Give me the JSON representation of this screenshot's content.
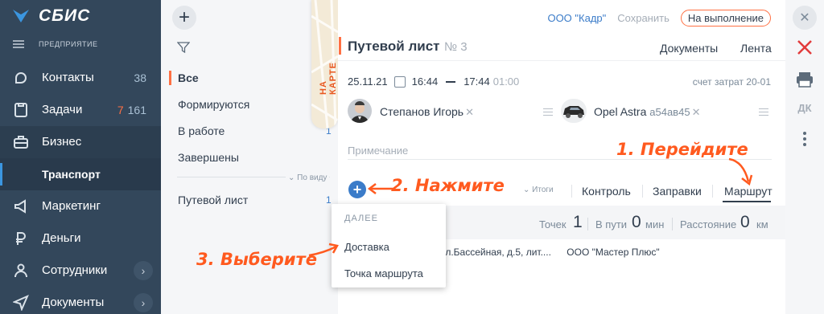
{
  "app": {
    "logo_text": "СБИС",
    "org_label": "ПРЕДПРИЯТИЕ"
  },
  "sidebar": {
    "items": [
      {
        "label": "Контакты",
        "count": "38",
        "icon": "contacts-icon"
      },
      {
        "label": "Задачи",
        "count_red": "7",
        "count": "161",
        "icon": "tasks-icon"
      },
      {
        "label": "Бизнес",
        "icon": "briefcase-icon"
      },
      {
        "label": "Транспорт"
      },
      {
        "label": "Маркетинг",
        "icon": "megaphone-icon"
      },
      {
        "label": "Деньги",
        "icon": "ruble-icon"
      },
      {
        "label": "Сотрудники",
        "icon": "people-icon"
      },
      {
        "label": "Документы",
        "icon": "send-icon"
      }
    ]
  },
  "filters": {
    "items": [
      {
        "label": "Все"
      },
      {
        "label": "Формируются"
      },
      {
        "label": "В работе",
        "count": "1"
      },
      {
        "label": "Завершены"
      }
    ],
    "by_view": "По виду",
    "type_item": {
      "label": "Путевой лист",
      "count": "1"
    },
    "map_tab": "НА КАРТЕ"
  },
  "document": {
    "org": "ООО \"Кадр\"",
    "save": "Сохранить",
    "status": "На выполнение",
    "title": "Путевой лист",
    "number": "№ 3",
    "tabs": [
      "Документы",
      "Лента"
    ],
    "date": "25.11.21",
    "time_from": "16:44",
    "time_to": "17:44",
    "duration": "01:00",
    "cost_account": "счет затрат 20-01",
    "driver": "Степанов Игорь",
    "car_model": "Opel Astra",
    "car_plate": "а54ав45",
    "note_placeholder": "Примечание",
    "itogi": "Итоги",
    "subtabs": [
      "Контроль",
      "Заправки",
      "Маршрут"
    ],
    "summary": {
      "points_label": "Точек",
      "points": "1",
      "travel_label": "В пути",
      "travel": "0",
      "travel_unit": "мин",
      "distance_label": "Расстояние",
      "distance": "0",
      "distance_unit": "км"
    },
    "route_address": "г, ул.Бассейная, д.5, лит....",
    "route_org": "ООО \"Мастер Плюс\""
  },
  "dropdown": {
    "header": "ДАЛЕЕ",
    "items": [
      "Доставка",
      "Точка маршрута"
    ]
  },
  "right_bar": {
    "dk": "ДК"
  },
  "annotations": {
    "step1": "1. Перейдите",
    "step2": "2. Нажмите",
    "step3": "3. Выберите"
  },
  "colors": {
    "sidebar": "#33475b",
    "accent": "#ff7043",
    "link": "#3b7cc9",
    "annotation": "#ff5a1f"
  }
}
